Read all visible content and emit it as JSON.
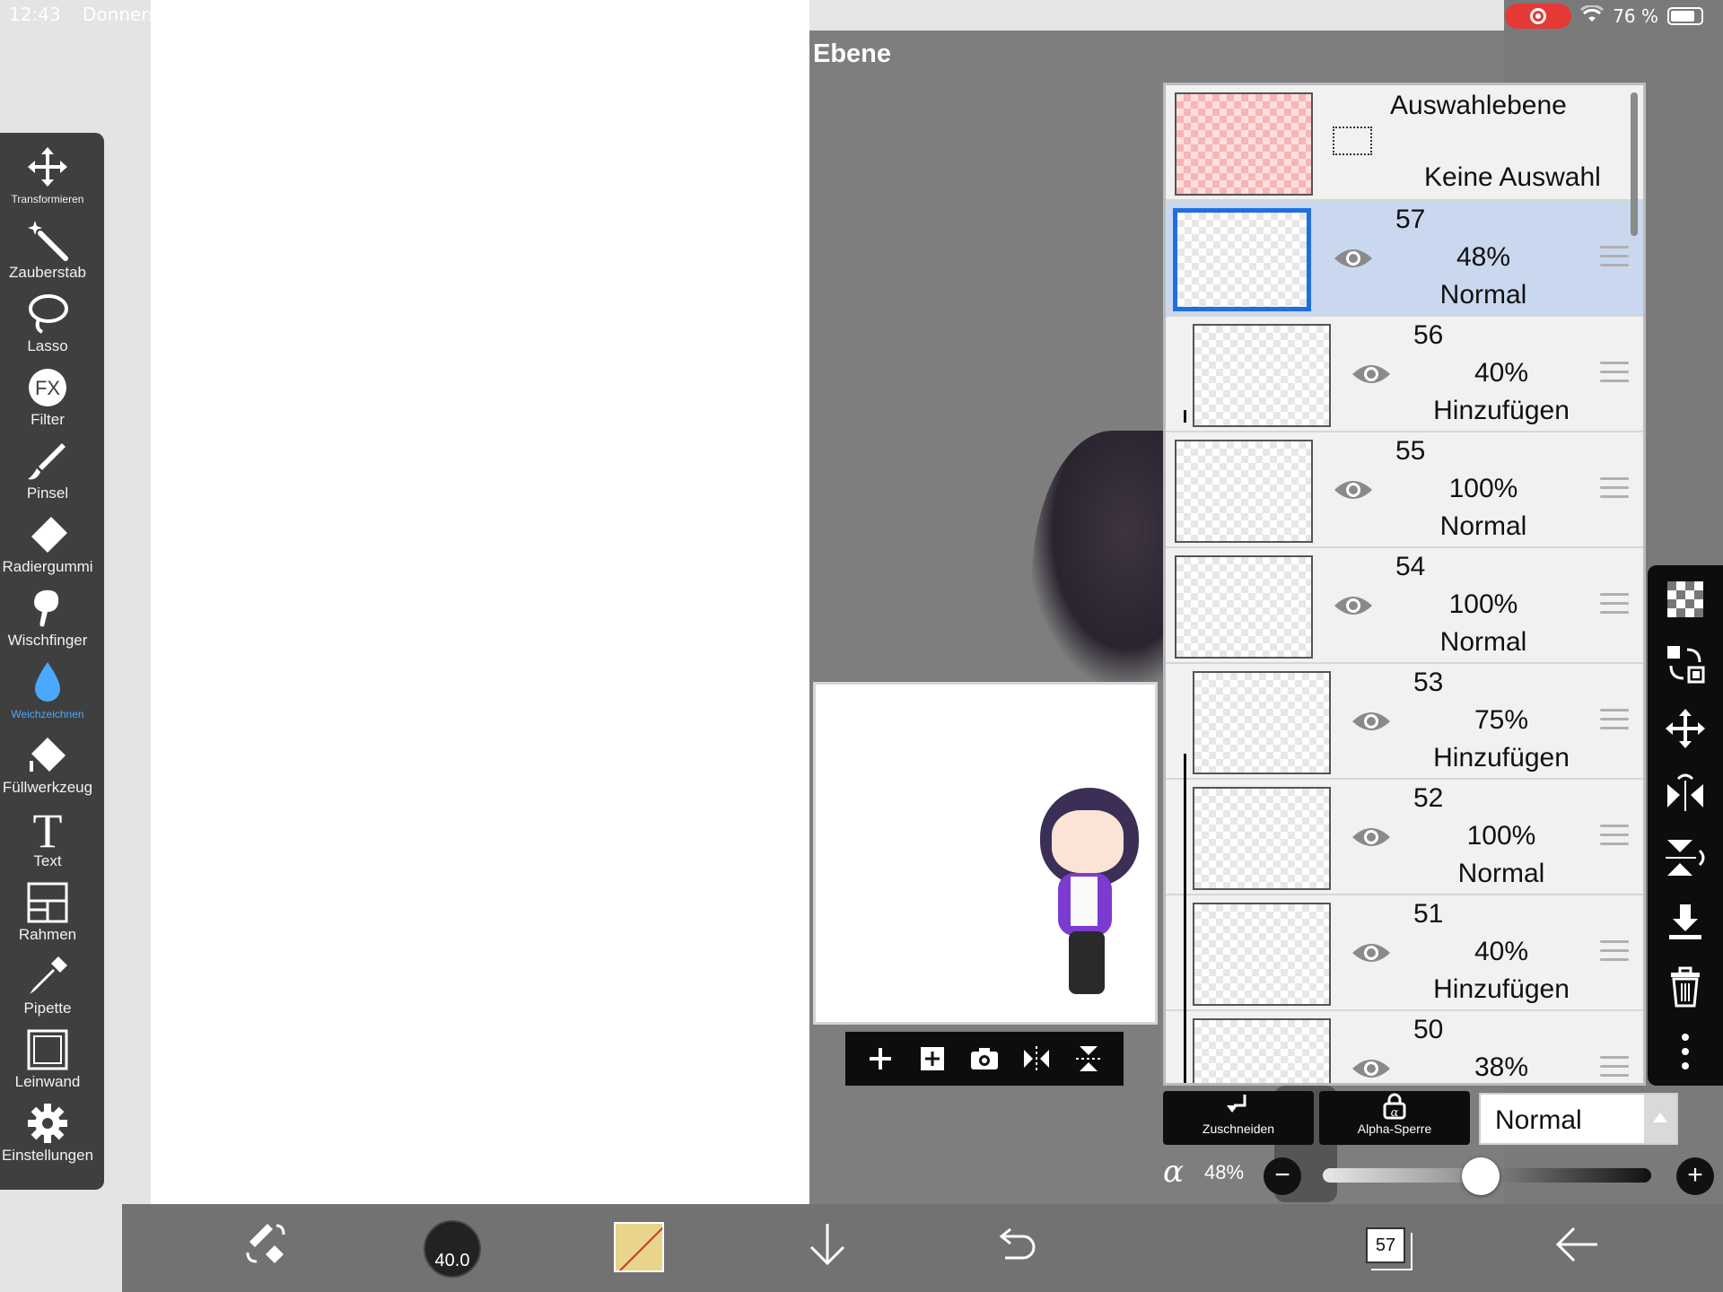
{
  "status_bar": {
    "time": "12:43",
    "day": "Donners",
    "battery": "76 %"
  },
  "panel": {
    "title": "Ebene"
  },
  "tools": [
    {
      "label": "Transformieren",
      "icon": "move-arrows-icon"
    },
    {
      "label": "Zauberstab",
      "icon": "magic-wand-icon"
    },
    {
      "label": "Lasso",
      "icon": "lasso-icon"
    },
    {
      "label": "Filter",
      "icon": "fx-icon"
    },
    {
      "label": "Pinsel",
      "icon": "brush-icon"
    },
    {
      "label": "Radiergummi",
      "icon": "eraser-icon"
    },
    {
      "label": "Wischfinger",
      "icon": "smudge-icon"
    },
    {
      "label": "Weichzeichnen",
      "icon": "blur-drop-icon"
    },
    {
      "label": "Füllwerkzeug",
      "icon": "fill-bucket-icon"
    },
    {
      "label": "Text",
      "icon": "text-icon"
    },
    {
      "label": "Rahmen",
      "icon": "frame-icon"
    },
    {
      "label": "Pipette",
      "icon": "eyedropper-icon"
    },
    {
      "label": "Leinwand",
      "icon": "canvas-icon"
    },
    {
      "label": "Einstellungen",
      "icon": "gear-icon"
    }
  ],
  "selection_layer": {
    "title": "Auswahlebene",
    "subtitle": "Keine Auswahl"
  },
  "layers": [
    {
      "number": "57",
      "opacity": "48%",
      "mode": "Normal",
      "clipped": false,
      "selected": true
    },
    {
      "number": "56",
      "opacity": "40%",
      "mode": "Hinzufügen",
      "clipped": true,
      "selected": false
    },
    {
      "number": "55",
      "opacity": "100%",
      "mode": "Normal",
      "clipped": false,
      "selected": false
    },
    {
      "number": "54",
      "opacity": "100%",
      "mode": "Normal",
      "clipped": false,
      "selected": false
    },
    {
      "number": "53",
      "opacity": "75%",
      "mode": "Hinzufügen",
      "clipped": true,
      "selected": false
    },
    {
      "number": "52",
      "opacity": "100%",
      "mode": "Normal",
      "clipped": true,
      "selected": false
    },
    {
      "number": "51",
      "opacity": "40%",
      "mode": "Hinzufügen",
      "clipped": true,
      "selected": false
    },
    {
      "number": "50",
      "opacity": "38%",
      "mode": "",
      "clipped": true,
      "selected": false
    }
  ],
  "layer_controls": {
    "clip_label": "Zuschneiden",
    "alpha_lock_label": "Alpha-Sperre",
    "alpha_lock_glyph": "α",
    "blend_mode": "Normal",
    "alpha_symbol": "α",
    "opacity": "48%",
    "opacity_fraction": 0.48
  },
  "bottom_bar": {
    "brush_size": "40.0",
    "primary_color": "#e8d48a",
    "layer_count": "57"
  },
  "colors": {
    "accent_blue": "#1e6fe0",
    "selected_row": "#c9d8ee",
    "active_tool": "#4aa8ff",
    "record": "#e53935"
  }
}
